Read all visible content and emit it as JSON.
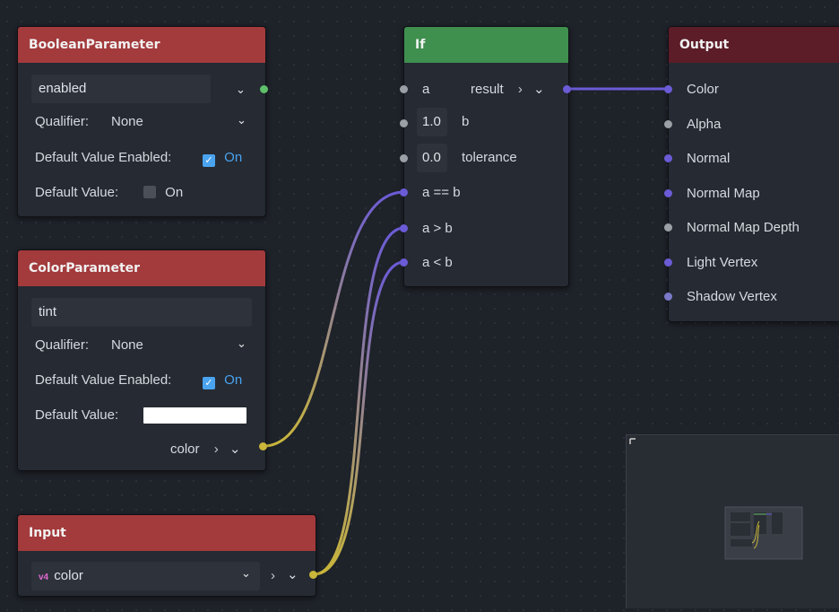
{
  "colors": {
    "bool_port": "#5fbf6a",
    "color_port": "#c9b63a",
    "vector_port": "#6b5bd6",
    "float_port": "#9aa0a6",
    "header_red": "#a33a3c",
    "header_green": "#3f8f4f",
    "header_output": "#5c1d28",
    "checkbox_on": "#4aa3ef"
  },
  "boolean_node": {
    "title": "BooleanParameter",
    "name_value": "enabled",
    "qualifier_label": "Qualifier:",
    "qualifier_value": "None",
    "default_enabled_label": "Default Value Enabled:",
    "default_enabled_state": "On",
    "default_value_label": "Default Value:",
    "default_value_state": "On"
  },
  "color_node": {
    "title": "ColorParameter",
    "name_value": "tint",
    "qualifier_label": "Qualifier:",
    "qualifier_value": "None",
    "default_enabled_label": "Default Value Enabled:",
    "default_enabled_state": "On",
    "default_value_label": "Default Value:",
    "default_color": "#ffffff",
    "output_label": "color"
  },
  "input_node": {
    "title": "Input",
    "type_icon": "vec4-icon",
    "type_icon_text": "v4",
    "selected": "color"
  },
  "if_node": {
    "title": "If",
    "inputs": {
      "a": "a",
      "b_value": "1.0",
      "b": "b",
      "tol_value": "0.0",
      "tolerance": "tolerance",
      "eq": "a == b",
      "gt": "a > b",
      "lt": "a < b"
    },
    "output": "result"
  },
  "output_node": {
    "title": "Output",
    "ports": [
      "Color",
      "Alpha",
      "Normal",
      "Normal Map",
      "Normal Map Depth",
      "Light Vertex",
      "Shadow Vertex"
    ]
  }
}
